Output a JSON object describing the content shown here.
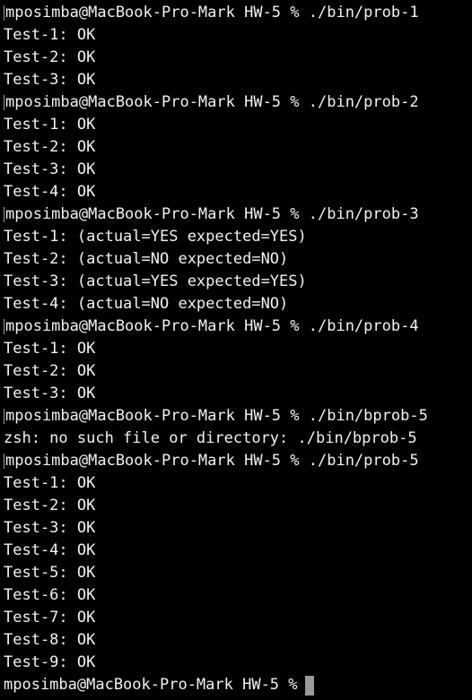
{
  "terminal": {
    "lines": [
      {
        "text": "mposimba@MacBook-Pro-Mark HW-5 % ./bin/prob-1",
        "kind": "prompt"
      },
      {
        "text": "Test-1: OK",
        "kind": "output"
      },
      {
        "text": "Test-2: OK",
        "kind": "output"
      },
      {
        "text": "Test-3: OK",
        "kind": "output"
      },
      {
        "text": "mposimba@MacBook-Pro-Mark HW-5 % ./bin/prob-2",
        "kind": "prompt"
      },
      {
        "text": "Test-1: OK",
        "kind": "output"
      },
      {
        "text": "Test-2: OK",
        "kind": "output"
      },
      {
        "text": "Test-3: OK",
        "kind": "output"
      },
      {
        "text": "Test-4: OK",
        "kind": "output"
      },
      {
        "text": "mposimba@MacBook-Pro-Mark HW-5 % ./bin/prob-3",
        "kind": "prompt"
      },
      {
        "text": "Test-1: (actual=YES expected=YES)",
        "kind": "output"
      },
      {
        "text": "Test-2: (actual=NO expected=NO)",
        "kind": "output"
      },
      {
        "text": "Test-3: (actual=YES expected=YES)",
        "kind": "output"
      },
      {
        "text": "Test-4: (actual=NO expected=NO)",
        "kind": "output"
      },
      {
        "text": "mposimba@MacBook-Pro-Mark HW-5 % ./bin/prob-4",
        "kind": "prompt"
      },
      {
        "text": "Test-1: OK",
        "kind": "output"
      },
      {
        "text": "Test-2: OK",
        "kind": "output"
      },
      {
        "text": "Test-3: OK",
        "kind": "output"
      },
      {
        "text": "mposimba@MacBook-Pro-Mark HW-5 % ./bin/bprob-5",
        "kind": "prompt"
      },
      {
        "text": "zsh: no such file or directory: ./bin/bprob-5",
        "kind": "output"
      },
      {
        "text": "mposimba@MacBook-Pro-Mark HW-5 % ./bin/prob-5",
        "kind": "prompt"
      },
      {
        "text": "Test-1: OK",
        "kind": "output"
      },
      {
        "text": "Test-2: OK",
        "kind": "output"
      },
      {
        "text": "Test-3: OK",
        "kind": "output"
      },
      {
        "text": "Test-4: OK",
        "kind": "output"
      },
      {
        "text": "Test-5: OK",
        "kind": "output"
      },
      {
        "text": "Test-6: OK",
        "kind": "output"
      },
      {
        "text": "Test-7: OK",
        "kind": "output"
      },
      {
        "text": "Test-8: OK",
        "kind": "output"
      },
      {
        "text": "Test-9: OK",
        "kind": "output"
      }
    ],
    "current_prompt": "mposimba@MacBook-Pro-Mark HW-5 %"
  },
  "colors": {
    "background": "#000000",
    "text": "#f2f2f2",
    "cursor": "#9a9a9a"
  }
}
